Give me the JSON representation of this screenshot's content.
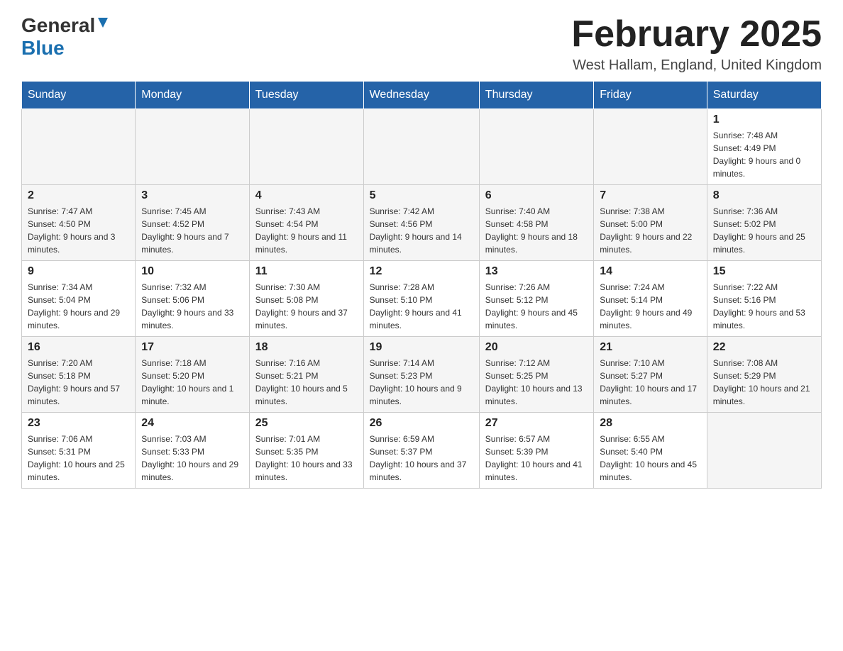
{
  "header": {
    "logo_general": "General",
    "logo_blue": "Blue",
    "month_title": "February 2025",
    "location": "West Hallam, England, United Kingdom"
  },
  "days_of_week": [
    "Sunday",
    "Monday",
    "Tuesday",
    "Wednesday",
    "Thursday",
    "Friday",
    "Saturday"
  ],
  "weeks": [
    [
      {
        "day": "",
        "sunrise": "",
        "sunset": "",
        "daylight": ""
      },
      {
        "day": "",
        "sunrise": "",
        "sunset": "",
        "daylight": ""
      },
      {
        "day": "",
        "sunrise": "",
        "sunset": "",
        "daylight": ""
      },
      {
        "day": "",
        "sunrise": "",
        "sunset": "",
        "daylight": ""
      },
      {
        "day": "",
        "sunrise": "",
        "sunset": "",
        "daylight": ""
      },
      {
        "day": "",
        "sunrise": "",
        "sunset": "",
        "daylight": ""
      },
      {
        "day": "1",
        "sunrise": "Sunrise: 7:48 AM",
        "sunset": "Sunset: 4:49 PM",
        "daylight": "Daylight: 9 hours and 0 minutes."
      }
    ],
    [
      {
        "day": "2",
        "sunrise": "Sunrise: 7:47 AM",
        "sunset": "Sunset: 4:50 PM",
        "daylight": "Daylight: 9 hours and 3 minutes."
      },
      {
        "day": "3",
        "sunrise": "Sunrise: 7:45 AM",
        "sunset": "Sunset: 4:52 PM",
        "daylight": "Daylight: 9 hours and 7 minutes."
      },
      {
        "day": "4",
        "sunrise": "Sunrise: 7:43 AM",
        "sunset": "Sunset: 4:54 PM",
        "daylight": "Daylight: 9 hours and 11 minutes."
      },
      {
        "day": "5",
        "sunrise": "Sunrise: 7:42 AM",
        "sunset": "Sunset: 4:56 PM",
        "daylight": "Daylight: 9 hours and 14 minutes."
      },
      {
        "day": "6",
        "sunrise": "Sunrise: 7:40 AM",
        "sunset": "Sunset: 4:58 PM",
        "daylight": "Daylight: 9 hours and 18 minutes."
      },
      {
        "day": "7",
        "sunrise": "Sunrise: 7:38 AM",
        "sunset": "Sunset: 5:00 PM",
        "daylight": "Daylight: 9 hours and 22 minutes."
      },
      {
        "day": "8",
        "sunrise": "Sunrise: 7:36 AM",
        "sunset": "Sunset: 5:02 PM",
        "daylight": "Daylight: 9 hours and 25 minutes."
      }
    ],
    [
      {
        "day": "9",
        "sunrise": "Sunrise: 7:34 AM",
        "sunset": "Sunset: 5:04 PM",
        "daylight": "Daylight: 9 hours and 29 minutes."
      },
      {
        "day": "10",
        "sunrise": "Sunrise: 7:32 AM",
        "sunset": "Sunset: 5:06 PM",
        "daylight": "Daylight: 9 hours and 33 minutes."
      },
      {
        "day": "11",
        "sunrise": "Sunrise: 7:30 AM",
        "sunset": "Sunset: 5:08 PM",
        "daylight": "Daylight: 9 hours and 37 minutes."
      },
      {
        "day": "12",
        "sunrise": "Sunrise: 7:28 AM",
        "sunset": "Sunset: 5:10 PM",
        "daylight": "Daylight: 9 hours and 41 minutes."
      },
      {
        "day": "13",
        "sunrise": "Sunrise: 7:26 AM",
        "sunset": "Sunset: 5:12 PM",
        "daylight": "Daylight: 9 hours and 45 minutes."
      },
      {
        "day": "14",
        "sunrise": "Sunrise: 7:24 AM",
        "sunset": "Sunset: 5:14 PM",
        "daylight": "Daylight: 9 hours and 49 minutes."
      },
      {
        "day": "15",
        "sunrise": "Sunrise: 7:22 AM",
        "sunset": "Sunset: 5:16 PM",
        "daylight": "Daylight: 9 hours and 53 minutes."
      }
    ],
    [
      {
        "day": "16",
        "sunrise": "Sunrise: 7:20 AM",
        "sunset": "Sunset: 5:18 PM",
        "daylight": "Daylight: 9 hours and 57 minutes."
      },
      {
        "day": "17",
        "sunrise": "Sunrise: 7:18 AM",
        "sunset": "Sunset: 5:20 PM",
        "daylight": "Daylight: 10 hours and 1 minute."
      },
      {
        "day": "18",
        "sunrise": "Sunrise: 7:16 AM",
        "sunset": "Sunset: 5:21 PM",
        "daylight": "Daylight: 10 hours and 5 minutes."
      },
      {
        "day": "19",
        "sunrise": "Sunrise: 7:14 AM",
        "sunset": "Sunset: 5:23 PM",
        "daylight": "Daylight: 10 hours and 9 minutes."
      },
      {
        "day": "20",
        "sunrise": "Sunrise: 7:12 AM",
        "sunset": "Sunset: 5:25 PM",
        "daylight": "Daylight: 10 hours and 13 minutes."
      },
      {
        "day": "21",
        "sunrise": "Sunrise: 7:10 AM",
        "sunset": "Sunset: 5:27 PM",
        "daylight": "Daylight: 10 hours and 17 minutes."
      },
      {
        "day": "22",
        "sunrise": "Sunrise: 7:08 AM",
        "sunset": "Sunset: 5:29 PM",
        "daylight": "Daylight: 10 hours and 21 minutes."
      }
    ],
    [
      {
        "day": "23",
        "sunrise": "Sunrise: 7:06 AM",
        "sunset": "Sunset: 5:31 PM",
        "daylight": "Daylight: 10 hours and 25 minutes."
      },
      {
        "day": "24",
        "sunrise": "Sunrise: 7:03 AM",
        "sunset": "Sunset: 5:33 PM",
        "daylight": "Daylight: 10 hours and 29 minutes."
      },
      {
        "day": "25",
        "sunrise": "Sunrise: 7:01 AM",
        "sunset": "Sunset: 5:35 PM",
        "daylight": "Daylight: 10 hours and 33 minutes."
      },
      {
        "day": "26",
        "sunrise": "Sunrise: 6:59 AM",
        "sunset": "Sunset: 5:37 PM",
        "daylight": "Daylight: 10 hours and 37 minutes."
      },
      {
        "day": "27",
        "sunrise": "Sunrise: 6:57 AM",
        "sunset": "Sunset: 5:39 PM",
        "daylight": "Daylight: 10 hours and 41 minutes."
      },
      {
        "day": "28",
        "sunrise": "Sunrise: 6:55 AM",
        "sunset": "Sunset: 5:40 PM",
        "daylight": "Daylight: 10 hours and 45 minutes."
      },
      {
        "day": "",
        "sunrise": "",
        "sunset": "",
        "daylight": ""
      }
    ]
  ]
}
